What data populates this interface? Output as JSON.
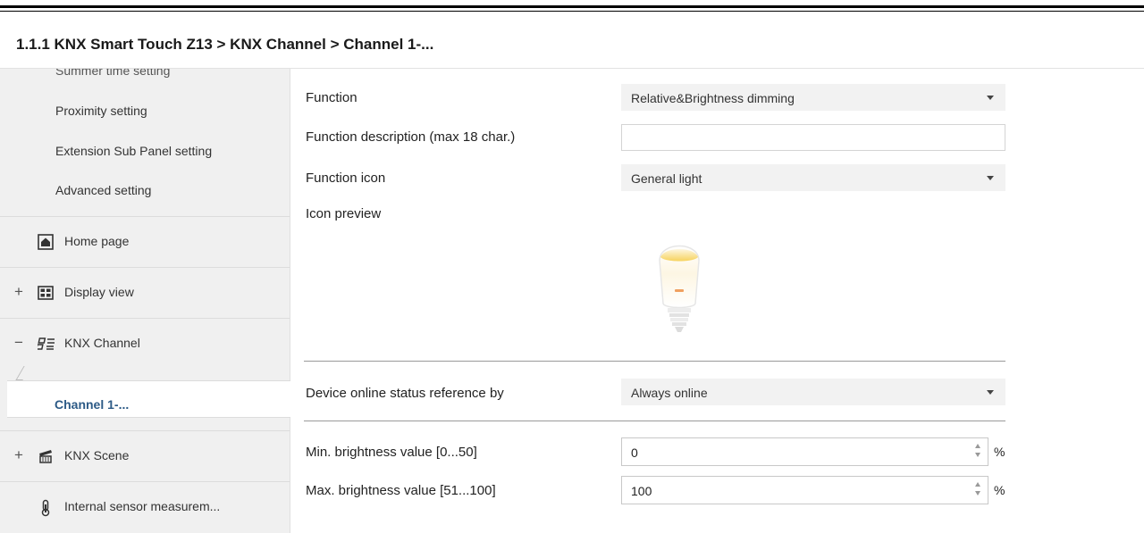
{
  "breadcrumb": "1.1.1 KNX Smart Touch Z13 > KNX Channel  > Channel 1-...",
  "sidebar": {
    "clipped_item": "Summer time setting",
    "sub_items": [
      "Proximity setting",
      "Extension Sub Panel setting",
      "Advanced setting"
    ],
    "nav_items": [
      {
        "label": "Home page",
        "expander": "",
        "icon": "home-icon"
      },
      {
        "label": "Display view",
        "expander": "+",
        "icon": "grid-icon"
      },
      {
        "label": "KNX Channel",
        "expander": "−",
        "icon": "channel-icon"
      },
      {
        "label": "KNX Scene",
        "expander": "+",
        "icon": "scene-icon"
      },
      {
        "label": "Internal sensor measurem...",
        "expander": "",
        "icon": "thermometer-icon"
      }
    ],
    "selected_item": "Channel 1-..."
  },
  "params": {
    "function_label": "Function",
    "function_value": "Relative&Brightness dimming",
    "description_label": "Function description (max 18 char.)",
    "description_value": "",
    "icon_label": "Function icon",
    "icon_value": "General light",
    "preview_label": "Icon preview",
    "preview_icon": "light-bulb-icon",
    "online_label": "Device online status reference by",
    "online_value": "Always online",
    "min_label": "Min. brightness value [0...50]",
    "min_value": "0",
    "min_unit": "%",
    "max_label": "Max. brightness value [51...100]",
    "max_value": "100",
    "max_unit": "%"
  },
  "colors": {
    "selected_text": "#2c5a86",
    "sidebar_bg": "#f0f0f0",
    "select_bg": "#f2f2f2",
    "bulb_glow": "#f5cc45"
  }
}
